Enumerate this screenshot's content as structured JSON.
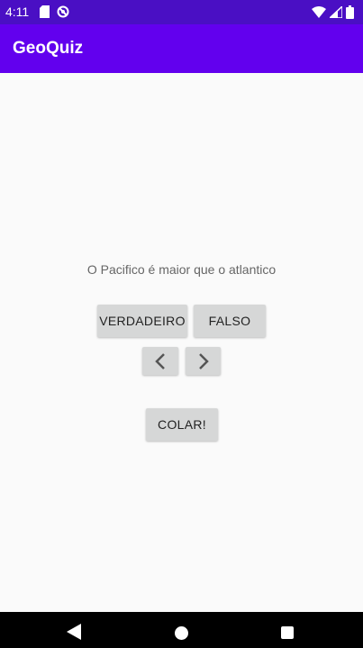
{
  "status_bar": {
    "time": "4:11",
    "icons_left": [
      "sd-card-icon",
      "no-disturb-icon"
    ],
    "icons_right": [
      "wifi-icon",
      "signal-icon",
      "battery-icon"
    ]
  },
  "app_bar": {
    "title": "GeoQuiz",
    "color": "#6200ee"
  },
  "question": {
    "text": "O Pacifico é maior que o atlantico"
  },
  "buttons": {
    "true_label": "VERDADEIRO",
    "false_label": "FALSO",
    "cheat_label": "COLAR!"
  },
  "nav_bar": {
    "icons": [
      "back-icon",
      "home-icon",
      "recents-icon"
    ]
  }
}
